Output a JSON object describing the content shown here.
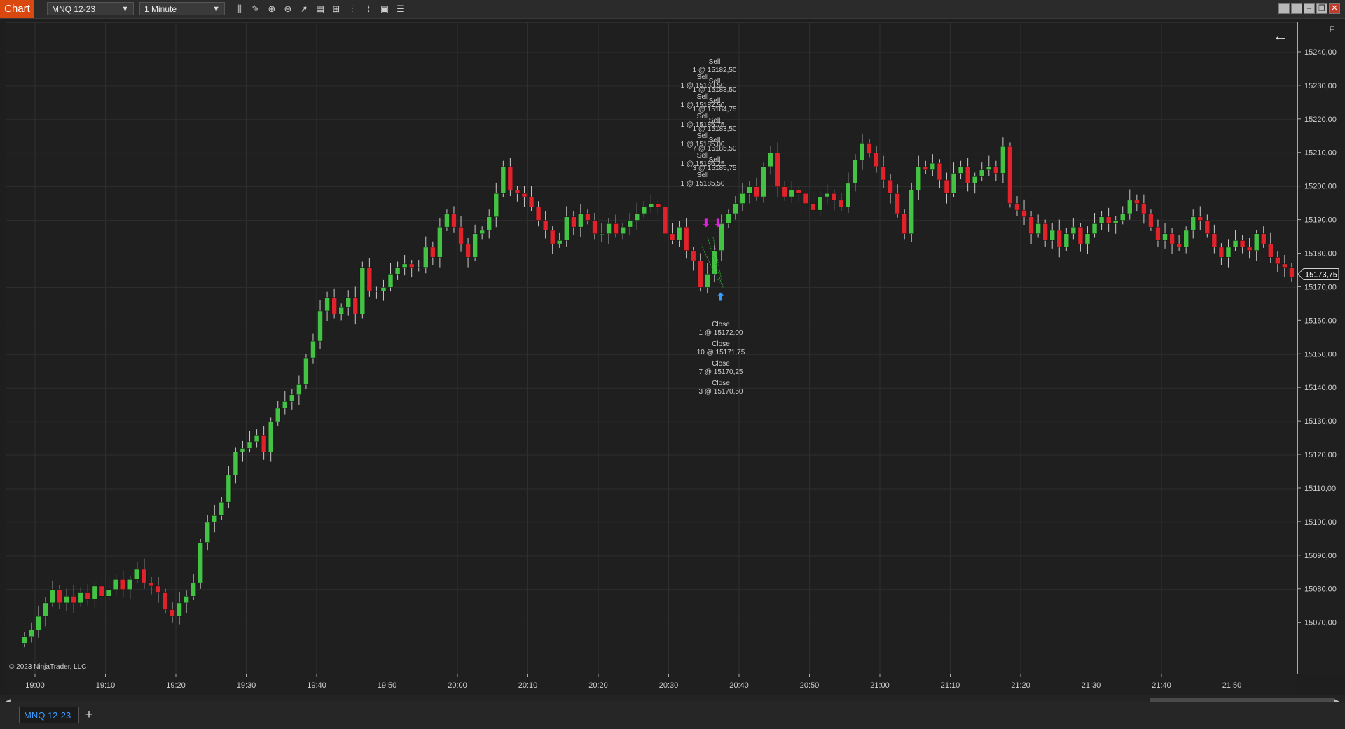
{
  "toolbar": {
    "badge": "Chart",
    "instrument": "MNQ 12-23",
    "interval": "1 Minute",
    "tools": [
      {
        "icon": "bar-chart-icon",
        "glyph": "⫼"
      },
      {
        "icon": "pencil-icon",
        "glyph": "✎"
      },
      {
        "icon": "zoom-in-icon",
        "glyph": "⊕"
      },
      {
        "icon": "zoom-out-icon",
        "glyph": "⊖"
      },
      {
        "icon": "pointer-icon",
        "glyph": "➚"
      },
      {
        "icon": "data-box-icon",
        "glyph": "▤"
      },
      {
        "icon": "templates-icon",
        "glyph": "⊞"
      },
      {
        "icon": "indicators-icon",
        "glyph": "⫶"
      },
      {
        "icon": "strategies-icon",
        "glyph": "⌇"
      },
      {
        "icon": "properties-icon",
        "glyph": "▣"
      },
      {
        "icon": "list-icon",
        "glyph": "☰"
      }
    ],
    "window_buttons": [
      {
        "icon": "restore-icon",
        "glyph": ""
      },
      {
        "icon": "tile-icon",
        "glyph": ""
      },
      {
        "icon": "minimize-icon",
        "glyph": "‒"
      },
      {
        "icon": "maximize-icon",
        "glyph": "❐"
      },
      {
        "icon": "close-icon",
        "glyph": "✕"
      }
    ]
  },
  "chart": {
    "copyright": "© 2023 NinjaTrader, LLC",
    "back_arrow": "←",
    "axis_flag": "F",
    "current_price": "15173,75",
    "colors": {
      "up": "#44c244",
      "down": "#e0222b",
      "grid": "#2f2f2f",
      "text": "#d0d0d0",
      "sell": "#e01fe0",
      "close": "#3b9cff"
    }
  },
  "chart_data": {
    "type": "candlestick",
    "instrument": "MNQ 12-23",
    "interval": "1 Minute",
    "x_ticks": [
      "19:00",
      "19:10",
      "19:20",
      "19:30",
      "19:40",
      "19:50",
      "20:00",
      "20:10",
      "20:20",
      "20:30",
      "20:40",
      "20:50",
      "21:00",
      "21:10",
      "21:20",
      "21:30",
      "21:40",
      "21:50"
    ],
    "y_ticks": [
      "15240,00",
      "15230,00",
      "15220,00",
      "15210,00",
      "15200,00",
      "15190,00",
      "15180,00",
      "15170,00",
      "15160,00",
      "15150,00",
      "15140,00",
      "15130,00",
      "15120,00",
      "15110,00",
      "15100,00",
      "15090,00",
      "15080,00",
      "15070,00"
    ],
    "ylim": [
      15062,
      15245
    ],
    "start_time": "18:58",
    "candles_close": [
      15066,
      15068,
      15072,
      15076,
      15080,
      15076,
      15078,
      15076,
      15079,
      15077,
      15081,
      15078,
      15080,
      15083,
      15080,
      15083,
      15086,
      15082,
      15081,
      15079,
      15074,
      15072,
      15076,
      15078,
      15082,
      15094,
      15100,
      15102,
      15106,
      15114,
      15121,
      15122,
      15124,
      15126,
      15121,
      15130,
      15134,
      15136,
      15138,
      15141,
      15149,
      15154,
      15163,
      15167,
      15162,
      15164,
      15167,
      15162,
      15176,
      15169,
      15169,
      15170,
      15174,
      15176,
      15177,
      15176,
      15176,
      15182,
      15179,
      15188,
      15192,
      15188,
      15183,
      15179,
      15186,
      15187,
      15191,
      15198,
      15206,
      15199,
      15198,
      15197,
      15194,
      15190,
      15187,
      15183,
      15184,
      15191,
      15188,
      15192,
      15190,
      15186,
      15186,
      15189,
      15186,
      15188,
      15190,
      15192,
      15194,
      15195,
      15194,
      15186,
      15184,
      15188,
      15181,
      15178,
      15170,
      15174,
      15181,
      15189,
      15192,
      15195,
      15198,
      15200,
      15197,
      15206,
      15210,
      15200,
      15197,
      15199,
      15198,
      15195,
      15193,
      15197,
      15198,
      15196,
      15194,
      15201,
      15208,
      15213,
      15210,
      15206,
      15202,
      15198,
      15192,
      15186,
      15199,
      15206,
      15205,
      15207,
      15202,
      15198,
      15204,
      15206,
      15201,
      15203,
      15205,
      15206,
      15204,
      15212,
      15195,
      15193,
      15191,
      15186,
      15189,
      15184,
      15187,
      15182,
      15186,
      15188,
      15183,
      15186,
      15189,
      15191,
      15189,
      15190,
      15192,
      15196,
      15195,
      15192,
      15188,
      15184,
      15186,
      15183,
      15182,
      15187,
      15191,
      15190,
      15186,
      15182,
      15179,
      15182,
      15184,
      15182,
      15181,
      15186,
      15183,
      15179,
      15177,
      15176,
      15173
    ],
    "executions": {
      "sells": [
        {
          "side": "Sell",
          "text": "1 @ 15182,50"
        },
        {
          "side": "Sell",
          "text": "1 @ 15183,50"
        },
        {
          "side": "Sell",
          "text": "1 @ 15183,50"
        },
        {
          "side": "Sell",
          "text": "1 @ 15182,50"
        },
        {
          "side": "Sell",
          "text": "1 @ 15184,75"
        },
        {
          "side": "Sell",
          "text": "1 @ 15185,75"
        },
        {
          "side": "Sell",
          "text": "1 @ 15183,50"
        },
        {
          "side": "Sell",
          "text": "1 @ 15185,00"
        },
        {
          "side": "Sell",
          "text": "7 @ 15185,50"
        },
        {
          "side": "Sell",
          "text": "1 @ 15186,25"
        },
        {
          "side": "Sell",
          "text": "3 @ 15185,75"
        },
        {
          "side": "Sell",
          "text": "1 @ 15185,50"
        }
      ],
      "closes": [
        {
          "side": "Close",
          "text": "1 @ 15172,00"
        },
        {
          "side": "Close",
          "text": "10 @ 15171,75"
        },
        {
          "side": "Close",
          "text": "7 @ 15170,25"
        },
        {
          "side": "Close",
          "text": "3 @ 15170,50"
        }
      ]
    }
  },
  "tabs": [
    {
      "label": "MNQ 12-23"
    }
  ],
  "add_tab": "+"
}
